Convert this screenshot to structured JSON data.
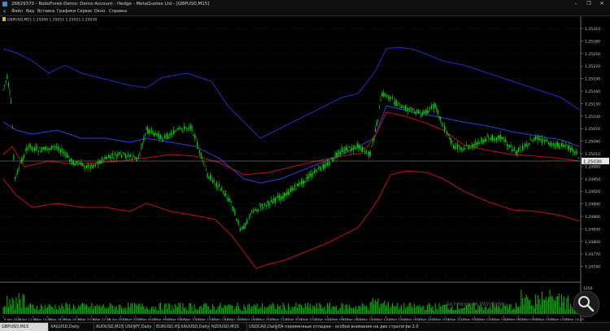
{
  "window": {
    "title": "26829370 - RoboForex-Demo: Demo Account - Hedge - MetaQuotes Ltd - [GBPUSD,M15]",
    "controls": [
      "–",
      "❐",
      "✕"
    ]
  },
  "menu": {
    "items": [
      "Файл",
      "Вид",
      "Вставка",
      "Графики",
      "Сервис",
      "Окно",
      "Справка"
    ]
  },
  "chart": {
    "header": "GBPUSD,M15  1.25040 1.25051 1.25025 1.25039",
    "current_price": "1.25030",
    "price_labels": [
      "1.25310",
      "1.25280",
      "1.25250",
      "1.25220",
      "1.25190",
      "1.25160",
      "1.25130",
      "1.25100",
      "1.25070",
      "1.25040",
      "1.25010",
      "1.24980",
      "1.24950",
      "1.24920",
      "1.24890",
      "1.24860",
      "1.24830",
      "1.24800",
      "1.24770",
      "1.24740"
    ],
    "volume_labels": [
      "0",
      "1250"
    ],
    "time_labels": [
      "9 Apr 2024",
      "9 Apr 12:15",
      "9 Apr 14:15",
      "9 Apr 16:15",
      "9 Apr 18:15",
      "9 Apr 20:15",
      "9 Apr 22:15",
      "10 Apr 00:15",
      "10 Apr 02:15",
      "10 Apr 04:15",
      "10 Apr 06:15",
      "10 Apr 08:15",
      "10 Apr 10:15",
      "10 Apr 12:15",
      "10 Apr 14:15",
      "10 Apr 16:15",
      "10 Apr 18:15",
      "10 Apr 20:15",
      "10 Apr 22:15",
      "11 Apr 00:15",
      "11 Apr 02:15",
      "11 Apr 04:15",
      "11 Apr 06:15",
      "11 Apr 08:15",
      "11 Apr 10:15",
      "11 Apr 12:15",
      "11 Apr 14:15",
      "11 Apr 16:15",
      "11 Apr 18:15",
      "11 Apr 20:15",
      "11 Apr 22:15",
      "12 Apr 00:15",
      "12 Apr 02:15",
      "12 Apr 04:15",
      "12 Apr 06:15",
      "12 Apr 08:15",
      "12 Apr 10:15",
      "12 Apr 12:15",
      "12 Apr 14:15"
    ],
    "colors": {
      "background": "#000000",
      "candle": "#00e000",
      "upper_band": "#1a2fc8",
      "middle_band": "#2a3fe0",
      "lower_band": "#c01010",
      "grid": "#3a3a3a",
      "volume": "#00c000",
      "axis_text": "#c8c8c8"
    },
    "indicators": [
      "bollinger-upper-blue",
      "bollinger-middle-blue",
      "bollinger-lower-red",
      "envelope-red"
    ]
  },
  "watermark": {
    "line1": "Активация Windows",
    "line2": "Чтобы активировать Windows, перейдите в раздел \"Параметры\"."
  },
  "tabs": [
    {
      "label": "GBPUSD,M15",
      "active": true
    },
    {
      "label": "XAGUSD,Daily",
      "active": false
    },
    {
      "label": "AUDUSD,M15",
      "active": false
    },
    {
      "label": "USDJPY,Daily",
      "active": false
    },
    {
      "label": "EURUSD,H1",
      "active": false
    },
    {
      "label": "XAUUSD,Daily",
      "active": false
    },
    {
      "label": "NZDUSD,M15",
      "active": false
    },
    {
      "label": "USDCAD,Daily",
      "active": false
    },
    {
      "label": "EA переменные отладки - особой внимание на две стратегии 2.0",
      "active": false
    }
  ]
}
